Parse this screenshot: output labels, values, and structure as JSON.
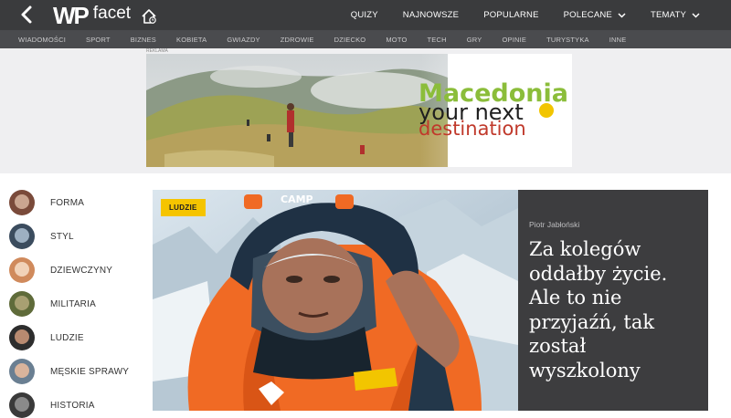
{
  "header": {
    "logo_text": "WP",
    "brand": "facet",
    "nav": [
      {
        "label": "QUIZY",
        "dropdown": false
      },
      {
        "label": "NAJNOWSZE",
        "dropdown": false
      },
      {
        "label": "POPULARNE",
        "dropdown": false
      },
      {
        "label": "POLECANE",
        "dropdown": true
      },
      {
        "label": "TEMATY",
        "dropdown": true
      }
    ]
  },
  "categories": [
    "WIADOMOŚCI",
    "SPORT",
    "BIZNES",
    "KOBIETA",
    "GWIAZDY",
    "ZDROWIE",
    "DZIECKO",
    "MOTO",
    "TECH",
    "GRY",
    "OPINIE",
    "TURYSTYKA",
    "INNE"
  ],
  "ad": {
    "label": "REKLAMA",
    "line1": "Macedonia",
    "line2": "your next",
    "line3": "destination"
  },
  "sidebar": {
    "items": [
      {
        "label": "FORMA"
      },
      {
        "label": "STYL"
      },
      {
        "label": "DZIEWCZYNY"
      },
      {
        "label": "MILITARIA"
      },
      {
        "label": "LUDZIE"
      },
      {
        "label": "MĘSKIE SPRAWY"
      },
      {
        "label": "HISTORIA"
      }
    ]
  },
  "featured": {
    "tag": "LUDZIE",
    "author": "Piotr Jabłoński",
    "title": "Za kolegów oddałby życie. Ale to nie przyjaźń, tak został wyszkolony",
    "helmet_brand": "CAMP"
  },
  "colors": {
    "topbar": "#3a3b3d",
    "subnav": "#4a4b4e",
    "tag": "#f5c400",
    "panel": "#3d3d3f"
  }
}
